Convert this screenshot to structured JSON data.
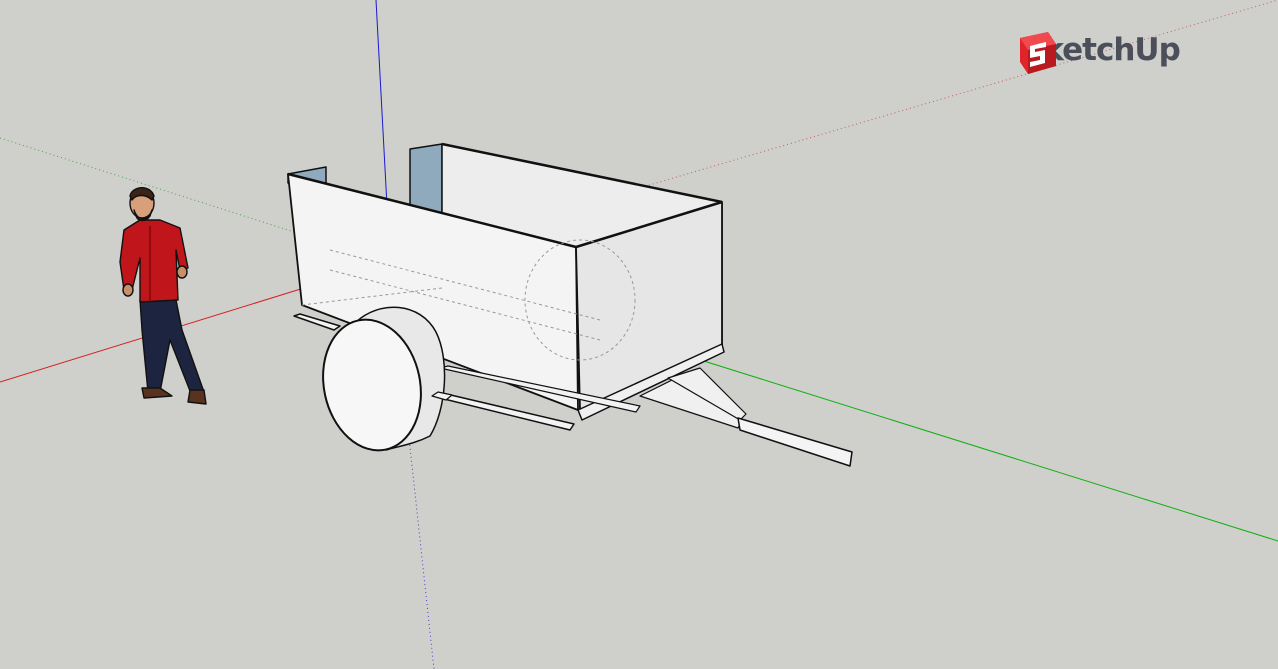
{
  "app": {
    "name": "SketchUp"
  },
  "viewport": {
    "background": "#cfcfcb",
    "axes": {
      "red": "#d22020",
      "green": "#10b010",
      "blue": "#1a1ad0"
    },
    "scale_figure": {
      "shirt_color": "#c0151a"
    },
    "model": {
      "face_color": "#f4f4f4",
      "back_face_color": "#8faabd",
      "edge_color": "#111111"
    }
  },
  "icons": {
    "logo": "sketchup-logo-icon"
  },
  "colors": {
    "brand_red": "#e0242a",
    "logo_text": "#4a4f5a"
  }
}
